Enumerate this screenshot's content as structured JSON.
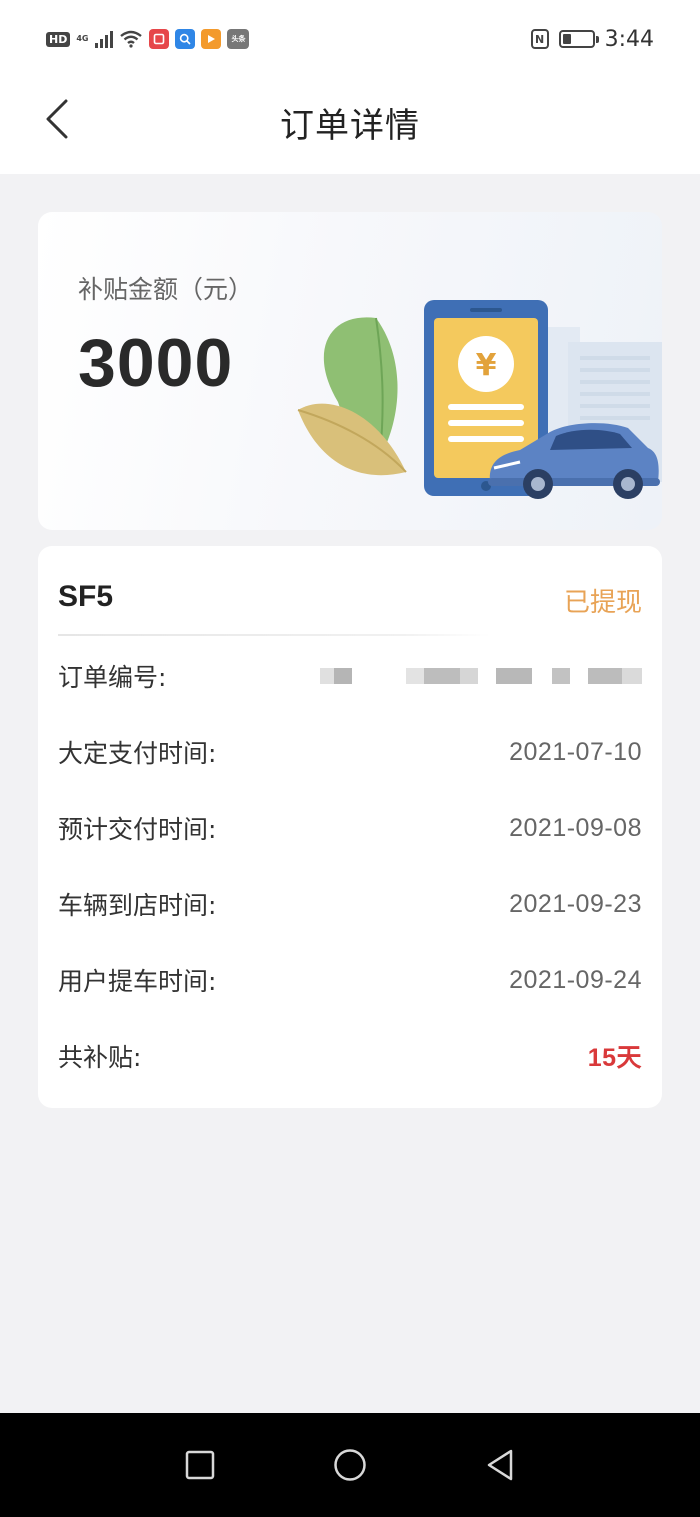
{
  "status_bar": {
    "left_icons": [
      "hd-icon",
      "signal-icon",
      "wifi-icon",
      "app-red-icon",
      "app-blue-icon",
      "app-orange-icon",
      "toutiao-icon"
    ],
    "network_label": "4G",
    "hd_label": "HD",
    "toutiao_label": "头条",
    "time": "3:44",
    "nfc_label": "N",
    "battery_level": 0.3
  },
  "header": {
    "title": "订单详情"
  },
  "banner": {
    "label": "补贴金额（元）",
    "amount": "3000",
    "currency_symbol": "¥"
  },
  "order": {
    "model": "SF5",
    "status": "已提现",
    "rows": [
      {
        "label": "订单编号:",
        "value": ""
      },
      {
        "label": "大定支付时间:",
        "value": "2021-07-10"
      },
      {
        "label": "预计交付时间:",
        "value": "2021-09-08"
      },
      {
        "label": "车辆到店时间:",
        "value": "2021-09-23"
      },
      {
        "label": "用户提车时间:",
        "value": "2021-09-24"
      },
      {
        "label": "共补贴:",
        "value": "15天"
      }
    ]
  },
  "colors": {
    "accent_orange": "#e8a356",
    "highlight_red": "#d9393a",
    "page_bg": "#f2f2f4"
  },
  "nav": {
    "icons": [
      "square-recents-icon",
      "circle-home-icon",
      "triangle-back-icon"
    ]
  }
}
